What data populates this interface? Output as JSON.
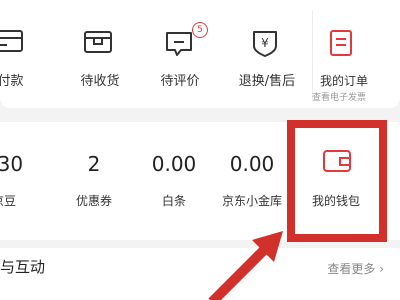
{
  "orders": {
    "items": [
      {
        "label": "待付款",
        "icon": "wallet-card-icon"
      },
      {
        "label": "待收货",
        "icon": "box-icon"
      },
      {
        "label": "待评价",
        "icon": "comment-icon",
        "badge": "5"
      },
      {
        "label": "退换/售后",
        "icon": "yen-shield-icon"
      }
    ],
    "my_orders_label": "我的订单",
    "my_orders_sub": "查看电子发票"
  },
  "assets": {
    "items": [
      {
        "value": "130",
        "label": "京豆"
      },
      {
        "value": "2",
        "label": "优惠券"
      },
      {
        "value": "0.00",
        "label": "白条"
      },
      {
        "value": "0.00",
        "label": "京东小金库"
      }
    ],
    "wallet_label": "我的钱包"
  },
  "section": {
    "title": "我与互动",
    "view_more": "查看更多 ›"
  },
  "colors": {
    "accent": "#e4393c",
    "highlight": "#d2302b",
    "icon": "#333333"
  }
}
